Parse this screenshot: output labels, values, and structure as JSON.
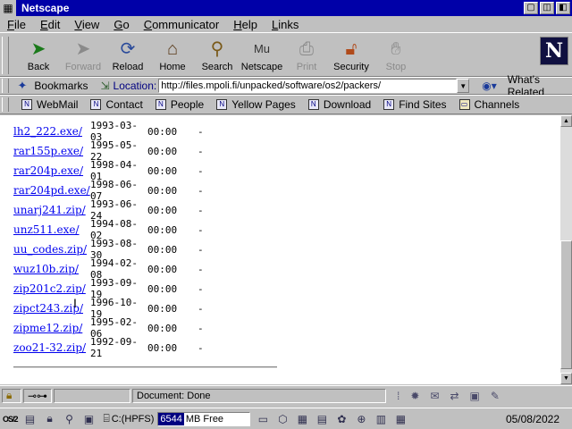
{
  "window": {
    "title": "Netscape"
  },
  "menu": [
    "File",
    "Edit",
    "View",
    "Go",
    "Communicator",
    "Help",
    "Links"
  ],
  "toolbar": {
    "buttons": [
      {
        "label": "Back",
        "icon": "back-arrow-icon",
        "enabled": true
      },
      {
        "label": "Forward",
        "icon": "forward-arrow-icon",
        "enabled": false
      },
      {
        "label": "Reload",
        "icon": "reload-icon",
        "enabled": true
      },
      {
        "label": "Home",
        "icon": "home-icon",
        "enabled": true
      },
      {
        "label": "Search",
        "icon": "search-icon",
        "enabled": true
      },
      {
        "label": "Netscape",
        "icon": "netscape-icon",
        "enabled": true
      },
      {
        "label": "Print",
        "icon": "print-icon",
        "enabled": false
      },
      {
        "label": "Security",
        "icon": "security-lock-icon",
        "enabled": true
      },
      {
        "label": "Stop",
        "icon": "stop-icon",
        "enabled": false
      }
    ],
    "logo": "N"
  },
  "location": {
    "bookmarks_label": "Bookmarks",
    "label": "Location:",
    "url": "http://files.mpoli.fi/unpacked/software/os2/packers/",
    "whats_related": "What's Related"
  },
  "personal": [
    "WebMail",
    "Contact",
    "People",
    "Yellow Pages",
    "Download",
    "Find Sites",
    "Channels"
  ],
  "files": [
    {
      "name": "lh2_222.exe/",
      "date": "1993-03-03",
      "time": "00:00",
      "size": "-"
    },
    {
      "name": "rar155p.exe/",
      "date": "1995-05-22",
      "time": "00:00",
      "size": "-"
    },
    {
      "name": "rar204p.exe/",
      "date": "1998-04-01",
      "time": "00:00",
      "size": "-"
    },
    {
      "name": "rar204pd.exe/",
      "date": "1998-06-07",
      "time": "00:00",
      "size": "-"
    },
    {
      "name": "unarj241.zip/",
      "date": "1993-06-24",
      "time": "00:00",
      "size": "-"
    },
    {
      "name": "unz511.exe/",
      "date": "1994-08-02",
      "time": "00:00",
      "size": "-"
    },
    {
      "name": "uu_codes.zip/",
      "date": "1993-08-30",
      "time": "00:00",
      "size": "-"
    },
    {
      "name": "wuz10b.zip/",
      "date": "1994-02-08",
      "time": "00:00",
      "size": "-"
    },
    {
      "name": "zip201c2.zip/",
      "date": "1993-09-19",
      "time": "00:00",
      "size": "-"
    },
    {
      "name": "zipct243.zip/",
      "date": "1996-10-19",
      "time": "00:00",
      "size": "-"
    },
    {
      "name": "zipme12.zip/",
      "date": "1995-02-06",
      "time": "00:00",
      "size": "-"
    },
    {
      "name": "zoo21-32.zip/",
      "date": "1992-09-21",
      "time": "00:00",
      "size": "-"
    }
  ],
  "status": {
    "message": "Document: Done"
  },
  "taskbar": {
    "drive_label": "C:(HPFS)",
    "free_value": "6544",
    "free_rest": "MB Free",
    "date": "05/08/2022"
  }
}
